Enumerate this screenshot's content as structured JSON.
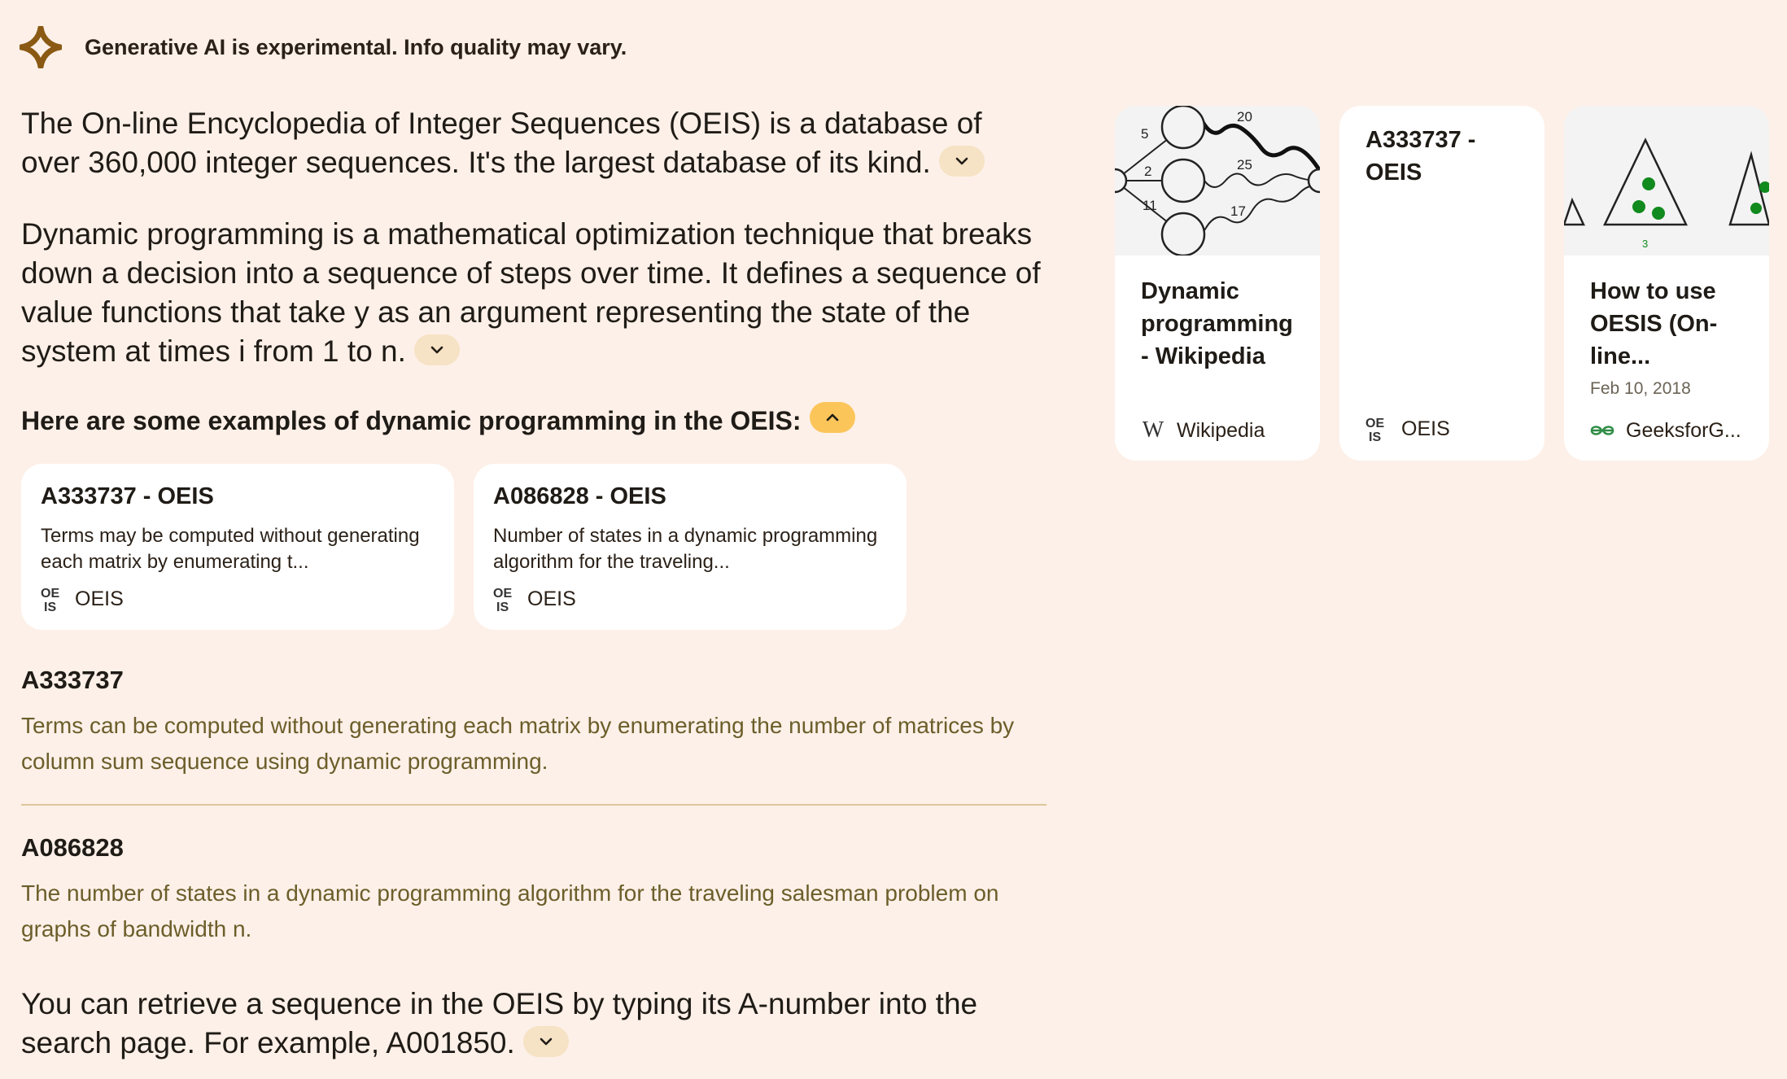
{
  "header": {
    "disclaimer": "Generative AI is experimental. Info quality may vary.",
    "icon": "spark-icon"
  },
  "paragraphs": [
    "The On-line Encyclopedia of Integer Sequences (OEIS) is a database of over 360,000 integer sequences. It's the largest database of its kind.",
    "Dynamic programming is a mathematical optimization technique that breaks down a decision into a sequence of steps over time. It defines a sequence of value functions that take y as an argument representing the state of the system at times i from 1 to n."
  ],
  "examples": {
    "heading": "Here are some examples of dynamic programming in the OEIS:",
    "cards": [
      {
        "title": "A333737 - OEIS",
        "snippet": "Terms may be computed without generating each matrix by enumerating t...",
        "source": "OEIS"
      },
      {
        "title": "A086828 - OEIS",
        "snippet": "Number of states in a dynamic programming algorithm for the traveling...",
        "source": "OEIS"
      }
    ]
  },
  "entries": [
    {
      "title": "A333737",
      "text": "Terms can be computed without generating each matrix by enumerating the number of matrices by column sum sequence using dynamic programming."
    },
    {
      "title": "A086828",
      "text": "The number of states in a dynamic programming algorithm for the traveling salesman problem on graphs of bandwidth n."
    }
  ],
  "final_paragraph": "You can retrieve a sequence in the OEIS by typing its A-number into the search page. For example, A001850.",
  "sources": [
    {
      "title": "Dynamic programming - Wikipedia",
      "source": "Wikipedia",
      "date": "",
      "thumb_labels": [
        "5",
        "20",
        "2",
        "25",
        "11",
        "17"
      ]
    },
    {
      "title": "A333737 - OEIS",
      "source": "OEIS",
      "date": ""
    },
    {
      "title": "How to use OESIS (On-line...",
      "source": "GeeksforG...",
      "date": "Feb 10, 2018",
      "thumb_labels": [
        "3"
      ]
    }
  ],
  "colors": {
    "background": "#fdf0e8",
    "chip": "#f6e2c4",
    "chip_active": "#fbc55a",
    "entry_text": "#6b5e2a",
    "spark": "#8a5a14"
  }
}
